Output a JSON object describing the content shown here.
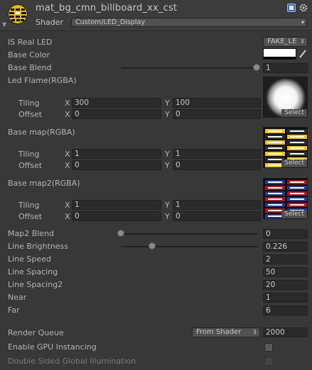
{
  "header": {
    "title": "mat_bg_cmn_billboard_xx_cst",
    "shader_label": "Shader",
    "shader_value": "Custom/LED_Display",
    "icons": [
      "material-sphere-icon",
      "help-book-icon",
      "settings-gear-icon"
    ]
  },
  "properties": {
    "is_real_led": {
      "label": "IS Real LED",
      "value": "FAKE_LE"
    },
    "base_color": {
      "label": "Base Color",
      "color": "#ffffff"
    },
    "base_blend": {
      "label": "Base Blend",
      "value": "1",
      "fraction": 1.0
    },
    "led_flame": {
      "label": "Led Flame(RGBA)",
      "tiling_label": "Tiling",
      "offset_label": "Offset",
      "tiling_x": "300",
      "tiling_y": "100",
      "offset_x": "0",
      "offset_y": "0",
      "select": "Select"
    },
    "base_map": {
      "label": "Base map(RGBA)",
      "tiling_label": "Tiling",
      "offset_label": "Offset",
      "tiling_x": "1",
      "tiling_y": "1",
      "offset_x": "0",
      "offset_y": "0",
      "select": "Select"
    },
    "base_map2": {
      "label": "Base map2(RGBA)",
      "tiling_label": "Tiling",
      "offset_label": "Offset",
      "tiling_x": "1",
      "tiling_y": "1",
      "offset_x": "0",
      "offset_y": "0",
      "select": "Select"
    },
    "axis_x": "X",
    "axis_y": "Y",
    "map2_blend": {
      "label": "Map2 Blend",
      "value": "0",
      "fraction": 0.0
    },
    "line_brightness": {
      "label": "Line Brightness",
      "value": "0.226",
      "fraction": 0.226
    },
    "line_speed": {
      "label": "Line Speed",
      "value": "2"
    },
    "line_spacing": {
      "label": "Line Spacing",
      "value": "50"
    },
    "line_spacing2": {
      "label": "Line Spacing2",
      "value": "20"
    },
    "near": {
      "label": "Near",
      "value": "1"
    },
    "far": {
      "label": "Far",
      "value": "6"
    }
  },
  "footer": {
    "render_queue": {
      "label": "Render Queue",
      "dropdown": "From Shader",
      "value": "2000"
    },
    "gpu_instancing": {
      "label": "Enable GPU Instancing",
      "checked": false
    },
    "double_sided_gi": {
      "label": "Double Sided Global Illumination",
      "checked": false
    }
  },
  "colors": {
    "background": "#383838",
    "field": "#2a2a2a",
    "text": "#b4b4b4",
    "led_texture_tile_yellow": "#f2c21a",
    "led_texture_tile_blue": "#1b3a9a",
    "led_texture_tile_red": "#b01818"
  }
}
